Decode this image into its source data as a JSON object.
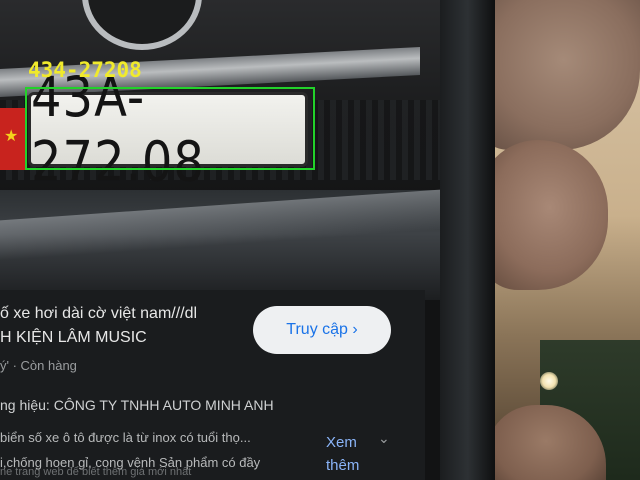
{
  "detection": {
    "label": "434-27208",
    "box_color": "#22d22a",
    "label_color": "#f0ea2c"
  },
  "plate": {
    "text": "43A-272.08"
  },
  "ad": {
    "title": "ố xe hơi dài cờ việt nam///dl",
    "brand": "H KIỆN LÂM MUSIC",
    "meta": "ý' · Còn hàng",
    "maker": "ng hiệu: CÔNG TY TNHH AUTO MINH ANH",
    "desc1": "biển số xe ô tô được là từ inox có tuổi thọ...",
    "desc2": "i,chống hoen gỉ, cong vênh Sản phẩm có đầy",
    "desc3": "ne trang web để biết thêm giá mới nhất",
    "more_label": "Xem thêm",
    "visit_label": "Truy cập ›"
  },
  "icons": {
    "star": "star-icon",
    "chevron": "chevron-down-icon"
  }
}
